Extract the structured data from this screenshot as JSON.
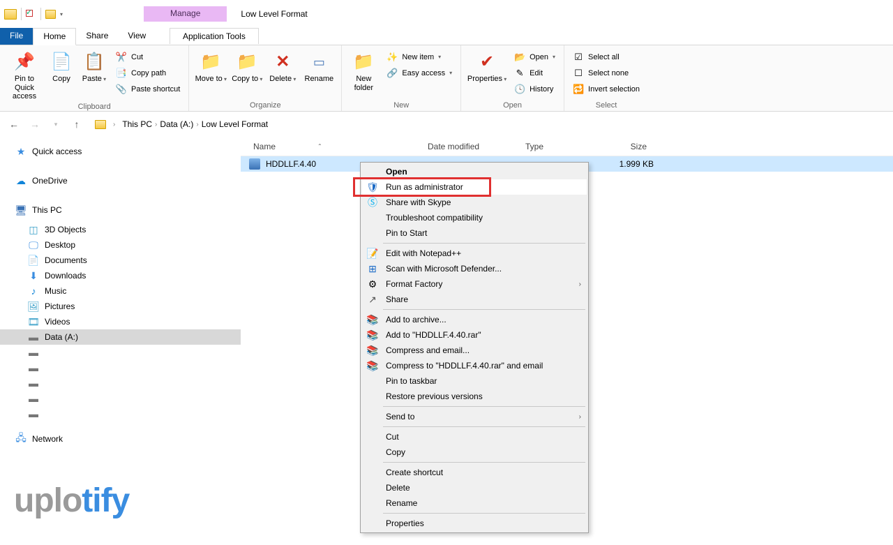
{
  "title": {
    "manage": "Manage",
    "app_tools": "Application Tools",
    "window": "Low Level Format"
  },
  "tabs": {
    "file": "File",
    "home": "Home",
    "share": "Share",
    "view": "View"
  },
  "ribbon": {
    "clipboard": {
      "label": "Clipboard",
      "pin": "Pin to Quick access",
      "copy": "Copy",
      "paste": "Paste",
      "cut": "Cut",
      "copy_path": "Copy path",
      "paste_shortcut": "Paste shortcut"
    },
    "organize": {
      "label": "Organize",
      "move_to": "Move to",
      "copy_to": "Copy to",
      "delete": "Delete",
      "rename": "Rename"
    },
    "new": {
      "label": "New",
      "new_folder": "New folder",
      "new_item": "New item",
      "easy_access": "Easy access"
    },
    "open": {
      "label": "Open",
      "properties": "Properties",
      "open": "Open",
      "edit": "Edit",
      "history": "History"
    },
    "select": {
      "label": "Select",
      "select_all": "Select all",
      "select_none": "Select none",
      "invert": "Invert selection"
    }
  },
  "breadcrumb": {
    "this_pc": "This PC",
    "drive": "Data (A:)",
    "folder": "Low Level Format"
  },
  "nav": {
    "quick_access": "Quick access",
    "onedrive": "OneDrive",
    "this_pc": "This PC",
    "three_d": "3D Objects",
    "desktop": "Desktop",
    "documents": "Documents",
    "downloads": "Downloads",
    "music": "Music",
    "pictures": "Pictures",
    "videos": "Videos",
    "data_a": "Data (A:)",
    "network": "Network"
  },
  "columns": {
    "name": "Name",
    "date": "Date modified",
    "type": "Type",
    "size": "Size"
  },
  "file": {
    "name": "HDDLLF.4.40",
    "size": "1.999 KB"
  },
  "ctx": {
    "open": "Open",
    "run_admin": "Run as administrator",
    "skype": "Share with Skype",
    "troubleshoot": "Troubleshoot compatibility",
    "pin_start": "Pin to Start",
    "notepadpp": "Edit with Notepad++",
    "defender": "Scan with Microsoft Defender...",
    "format_factory": "Format Factory",
    "share": "Share",
    "add_archive": "Add to archive...",
    "add_rar": "Add to \"HDDLLF.4.40.rar\"",
    "compress_email": "Compress and email...",
    "compress_rar_email": "Compress to \"HDDLLF.4.40.rar\" and email",
    "pin_taskbar": "Pin to taskbar",
    "restore": "Restore previous versions",
    "send_to": "Send to",
    "cut": "Cut",
    "copy": "Copy",
    "create_shortcut": "Create shortcut",
    "delete": "Delete",
    "rename": "Rename",
    "properties": "Properties"
  },
  "watermark": {
    "a": "uplo",
    "b": "tify"
  }
}
